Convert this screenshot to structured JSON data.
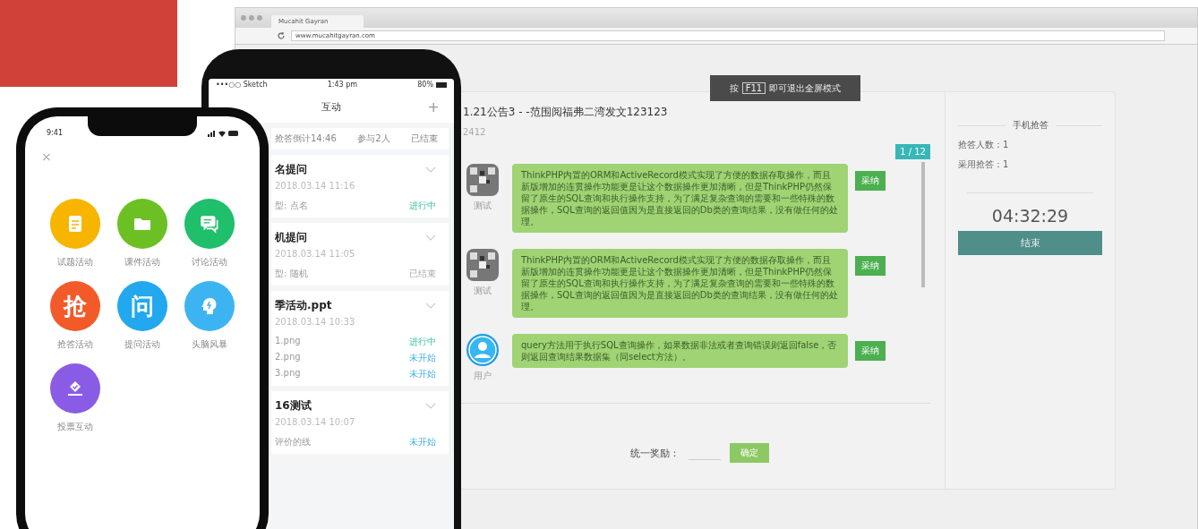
{
  "browser": {
    "tab_title": "Mucahit Gayran",
    "url": "www.mucahitgayran.com",
    "fullscreen_notice": {
      "before": "按",
      "key": "F11",
      "after": "即可退出全屏模式"
    },
    "post": {
      "title": "1.21公告3 - -范围阅福弗二湾发文123123",
      "subtitle": "2412"
    },
    "page_badge": "1 / 12",
    "messages": [
      {
        "kind": "pattern",
        "name": "测试",
        "text": "ThinkPHP内置的ORM和ActiveRecord模式实现了方便的数据存取操作，而且新版增加的连贯操作功能更是让这个数据操作更加清晰，但是ThinkPHP仍然保留了原生的SQL查询和执行操作支持，为了满足复杂查询的需要和一些特殊的数据操作，SQL查询的返回值因为是直接返回的Db类的查询结果，没有做任何的处理。",
        "action": "采纳"
      },
      {
        "kind": "pattern",
        "name": "测试",
        "text": "ThinkPHP内置的ORM和ActiveRecord模式实现了方便的数据存取操作，而且新版增加的连贯操作功能更是让这个数据操作更加清晰，但是ThinkPHP仍然保留了原生的SQL查询和执行操作支持，为了满足复杂查询的需要和一些特殊的数据操作，SQL查询的返回值因为是直接返回的Db类的查询结果，没有做任何的处理。",
        "action": "采纳"
      },
      {
        "kind": "person",
        "name": "用户",
        "text": "query方法用于执行SQL查询操作，如果数据非法或者查询错误则返回false，否则返回查询结果数据集（同select方法）。",
        "action": "采纳"
      }
    ],
    "reward": {
      "label": "统一奖励：",
      "button": "确定"
    },
    "side_panel": {
      "title": "手机抢答",
      "stats": [
        "抢答人数：1",
        "采用抢答：1"
      ],
      "timer": "04:32:29",
      "button": "结束"
    }
  },
  "phone_list": {
    "carrier": "•••○○ Sketch",
    "time": "1:43 pm",
    "battery": "80%",
    "title": "互动",
    "add": "+",
    "summary": [
      "抢答倒计14:46",
      "参与2人",
      "已结束"
    ],
    "cards": [
      {
        "title": "名提问",
        "date": "2018.03.14 11:16",
        "rows": [
          {
            "label": "型: 点名",
            "status": "进行中",
            "kind": "active"
          }
        ]
      },
      {
        "title": "机提问",
        "date": "2018.03.14 11:05",
        "rows": [
          {
            "label": "型: 随机",
            "status": "已结束",
            "kind": "ended"
          }
        ]
      },
      {
        "title": "季活动.ppt",
        "date": "2018.03.14 10:33",
        "rows": [
          {
            "label": "1.png",
            "status": "进行中",
            "kind": "active"
          },
          {
            "label": "2.png",
            "status": "未开始",
            "kind": "pending"
          },
          {
            "label": "3.png",
            "status": "未开始",
            "kind": "pending"
          }
        ]
      },
      {
        "title": "16测试",
        "date": "2018.03.14 10:07",
        "rows": [
          {
            "label": "评价的线",
            "status": "未开始",
            "kind": "pending"
          }
        ]
      }
    ]
  },
  "phone_menu": {
    "time": "9:41",
    "close": "×",
    "items": [
      {
        "label": "试题活动",
        "color": "#f7b500"
      },
      {
        "label": "课件活动",
        "color": "#6cc024"
      },
      {
        "label": "讨论活动",
        "color": "#1fbf6b"
      },
      {
        "label": "抢答活动",
        "glyph": "抢",
        "color": "#f25a2a"
      },
      {
        "label": "提问活动",
        "glyph": "问",
        "color": "#22a8ee"
      },
      {
        "label": "头脑风暴",
        "color": "#3cb4f2"
      },
      {
        "label": "投票互动",
        "color": "#8a5ce6"
      }
    ]
  }
}
